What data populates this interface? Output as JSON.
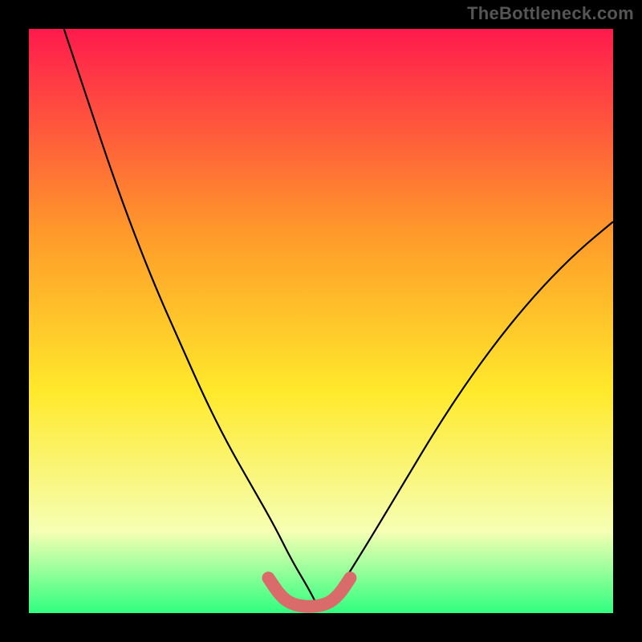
{
  "watermark": "TheBottleneck.com",
  "chart_data": {
    "type": "line",
    "title": "",
    "xlabel": "",
    "ylabel": "",
    "xlim": [
      0,
      100
    ],
    "ylim": [
      0,
      100
    ],
    "grid": false,
    "background_gradient": {
      "top": "#ff1a4d",
      "mid1": "#ff9a2a",
      "mid2": "#ffe92b",
      "mid3": "#f6ffb3",
      "bottom": "#2fff7f"
    },
    "series": [
      {
        "name": "bottleneck-curve",
        "x": [
          6,
          10,
          14,
          18,
          22,
          26,
          30,
          34,
          38,
          42,
          45,
          48,
          50,
          53,
          58,
          64,
          70,
          76,
          82,
          88,
          94,
          100
        ],
        "values": [
          100,
          88,
          76,
          65,
          55,
          46,
          37,
          29,
          22,
          15,
          9,
          4,
          0,
          4,
          12,
          22,
          32,
          41,
          49,
          56,
          62,
          67
        ]
      },
      {
        "name": "optimal-range-marker",
        "x": [
          41,
          43,
          45,
          48,
          51,
          53,
          55
        ],
        "values": [
          6,
          3,
          1.5,
          1,
          1.5,
          3,
          6
        ]
      }
    ]
  },
  "plot": {
    "border_px": 36,
    "inner_width": 728,
    "inner_height": 760
  },
  "colors": {
    "curve": "#000000",
    "marker": "#d96b6b",
    "border": "#000000"
  }
}
